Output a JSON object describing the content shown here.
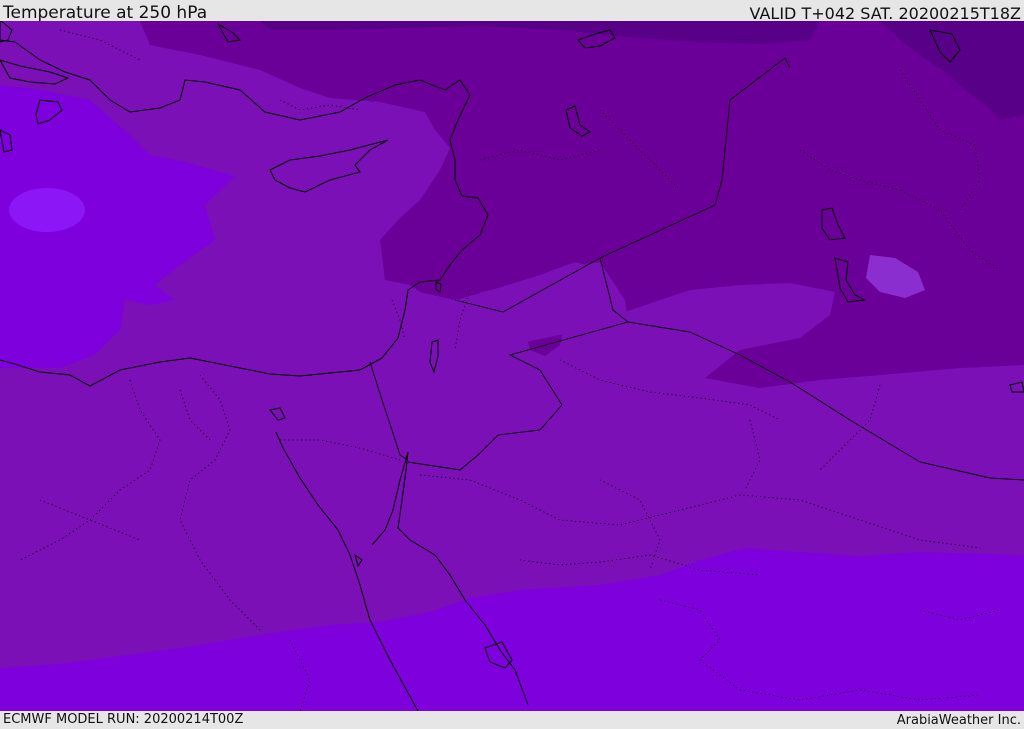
{
  "header": {
    "title": "Temperature at 250 hPa",
    "valid": "VALID T+042 SAT. 20200215T18Z"
  },
  "footer": {
    "model_run": "ECMWF MODEL RUN: 20200214T00Z",
    "credit": "ArabiaWeather Inc."
  },
  "colors": {
    "band_warm": "#7e00dc",
    "band_mid": "#7a10b6",
    "band_cool": "#6a0098",
    "band_cold": "#580088",
    "spot_warm": "#8c16f6",
    "spot_light": "#8a2ed0",
    "outline": "#000000"
  }
}
